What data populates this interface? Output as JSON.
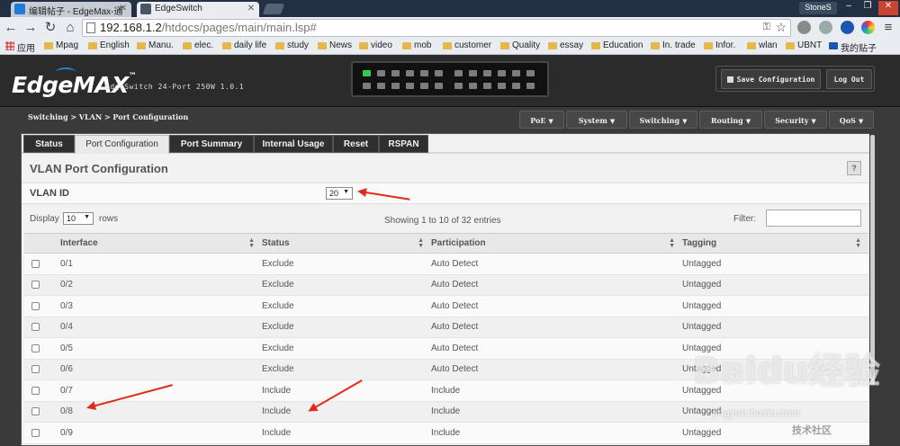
{
  "browser": {
    "tabs": [
      {
        "title": "编辑帖子 - EdgeMax-通",
        "active": false
      },
      {
        "title": "EdgeSwitch",
        "active": true
      }
    ],
    "user": "StoneS",
    "url_host": "192.168.1.2",
    "url_path": "/htdocs/pages/main/main.lsp#",
    "bookmarks": [
      "应用",
      "Mpag",
      "English",
      "Manu.",
      "elec.",
      "daily life",
      "study",
      "News",
      "video",
      "mob",
      "customer",
      "Quality",
      "essay",
      "Education",
      "In. trade",
      "Infor.",
      "wlan",
      "UBNT",
      "我的贴子"
    ]
  },
  "app": {
    "logo": "EdgeMAX",
    "logo_tm": "™",
    "model": "EdgeSwitch 24-Port 250W 1.0.1",
    "save_config": "Save Configuration",
    "logout": "Log Out",
    "breadcrumb": "Switching > VLAN > Port Configuration",
    "menus": [
      "PoE",
      "System",
      "Switching",
      "Routing",
      "Security",
      "QoS"
    ],
    "page_tabs": [
      "Status",
      "Port Configuration",
      "Port Summary",
      "Internal Usage",
      "Reset",
      "RSPAN"
    ],
    "active_tab": "Port Configuration"
  },
  "main": {
    "section_title": "VLAN Port Configuration",
    "help": "?",
    "vlan_id_label": "VLAN ID",
    "vlan_id_value": "20",
    "display_label": "Display",
    "display_value": "10",
    "rows_label": "rows",
    "entries_text": "Showing 1 to 10 of 32 entries",
    "filter_label": "Filter:",
    "filter_value": "",
    "table": {
      "columns": [
        "Interface",
        "Status",
        "Participation",
        "Tagging"
      ],
      "rows": [
        [
          "0/1",
          "Exclude",
          "Auto Detect",
          "Untagged"
        ],
        [
          "0/2",
          "Exclude",
          "Auto Detect",
          "Untagged"
        ],
        [
          "0/3",
          "Exclude",
          "Auto Detect",
          "Untagged"
        ],
        [
          "0/4",
          "Exclude",
          "Auto Detect",
          "Untagged"
        ],
        [
          "0/5",
          "Exclude",
          "Auto Detect",
          "Untagged"
        ],
        [
          "0/6",
          "Exclude",
          "Auto Detect",
          "Untagged"
        ],
        [
          "0/7",
          "Include",
          "Include",
          "Untagged"
        ],
        [
          "0/8",
          "Include",
          "Include",
          "Untagged"
        ],
        [
          "0/9",
          "Include",
          "Include",
          "Untagged"
        ]
      ]
    }
  },
  "watermark": {
    "brand": "Baidu经验",
    "domain": "jingyan.baidu.com",
    "corner": "技术社区"
  },
  "colors": {
    "annotation": "#e12a1c",
    "port_up": "#35c94a",
    "header_bg": "#2b2b2b"
  }
}
